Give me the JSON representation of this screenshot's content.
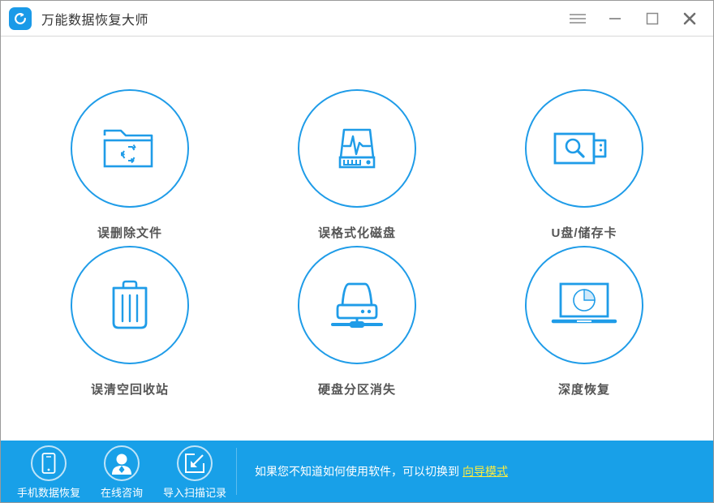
{
  "window": {
    "title": "万能数据恢复大师",
    "logo_icon": "recovery-logo-icon",
    "controls": [
      {
        "name": "menu-button",
        "icon": "hamburger-menu-icon"
      },
      {
        "name": "minimize-button",
        "icon": "minimize-icon"
      },
      {
        "name": "maximize-button",
        "icon": "maximize-icon"
      },
      {
        "name": "close-button",
        "icon": "close-icon"
      }
    ]
  },
  "colors": {
    "accent_blue": "#18a0e8",
    "icon_blue": "#1f9ce8",
    "label_gray": "#555555",
    "link_yellow": "#ffec3d",
    "window_border": "#9a9a9a"
  },
  "main": {
    "tiles": [
      {
        "id": "deleted-files",
        "label": "误删除文件",
        "icon": "folder-recycle-icon"
      },
      {
        "id": "formatted-disk",
        "label": "误格式化磁盘",
        "icon": "disk-waveform-icon"
      },
      {
        "id": "usb-memory-card",
        "label": "U盘/储存卡",
        "icon": "usb-search-icon"
      },
      {
        "id": "emptied-recyclebin",
        "label": "误清空回收站",
        "icon": "trash-bin-icon"
      },
      {
        "id": "lost-partition",
        "label": "硬盘分区消失",
        "icon": "external-hdd-icon"
      },
      {
        "id": "deep-recovery",
        "label": "深度恢复",
        "icon": "laptop-piechart-icon"
      }
    ]
  },
  "bottom": {
    "actions": [
      {
        "id": "phone-data-recovery",
        "label": "手机数据恢复",
        "icon": "mobile-phone-icon"
      },
      {
        "id": "online-consult",
        "label": "在线咨询",
        "icon": "person-avatar-icon"
      },
      {
        "id": "import-scan-record",
        "label": "导入扫描记录",
        "icon": "import-arrow-icon"
      }
    ],
    "hint_text": "如果您不知道如何使用软件，可以切换到",
    "hint_link": "向导模式"
  }
}
